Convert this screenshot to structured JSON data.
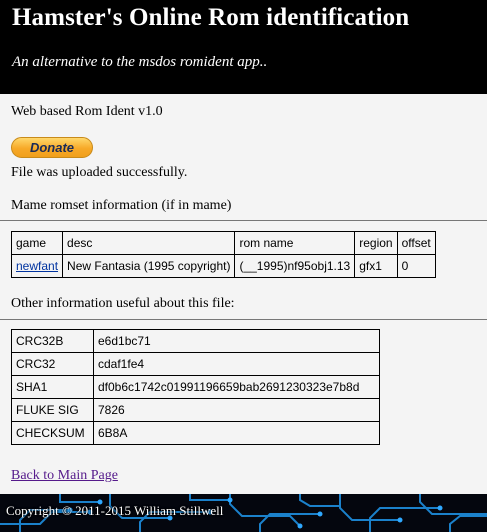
{
  "header": {
    "title": "Hamster's Online Rom identification",
    "tagline": "An alternative to the msdos romident app.."
  },
  "version_text": "Web based Rom Ident v1.0",
  "donate_label": "Donate",
  "upload_status": "File was uploaded successfully.",
  "romset_heading": "Mame romset information (if in mame)",
  "romset_table": {
    "headers": [
      "game",
      "desc",
      "rom name",
      "region",
      "offset"
    ],
    "row": {
      "game": "newfant",
      "desc": "New Fantasia (1995 copyright)",
      "rom_name": "(__1995)nf95obj1.13",
      "region": "gfx1",
      "offset": "0"
    }
  },
  "other_info_heading": "Other information useful about this file:",
  "file_info": {
    "crc32b_label": "CRC32B",
    "crc32b": "e6d1bc71",
    "crc32_label": "CRC32",
    "crc32": "cdaf1fe4",
    "sha1_label": "SHA1",
    "sha1": "df0b6c1742c01991196659bab2691230323e7b8d",
    "fluke_label": "FLUKE SIG",
    "fluke": "7826",
    "checksum_label": "CHECKSUM",
    "checksum": "6B8A"
  },
  "back_link": "Back to Main Page",
  "footer": {
    "copyright": "Copyright © 2011-2015 William Stillwell"
  },
  "colors": {
    "header_bg": "#000000",
    "page_bg": "#f4f4f4",
    "circuit": "#1e8fe0",
    "footer_bg": "#04060e"
  }
}
